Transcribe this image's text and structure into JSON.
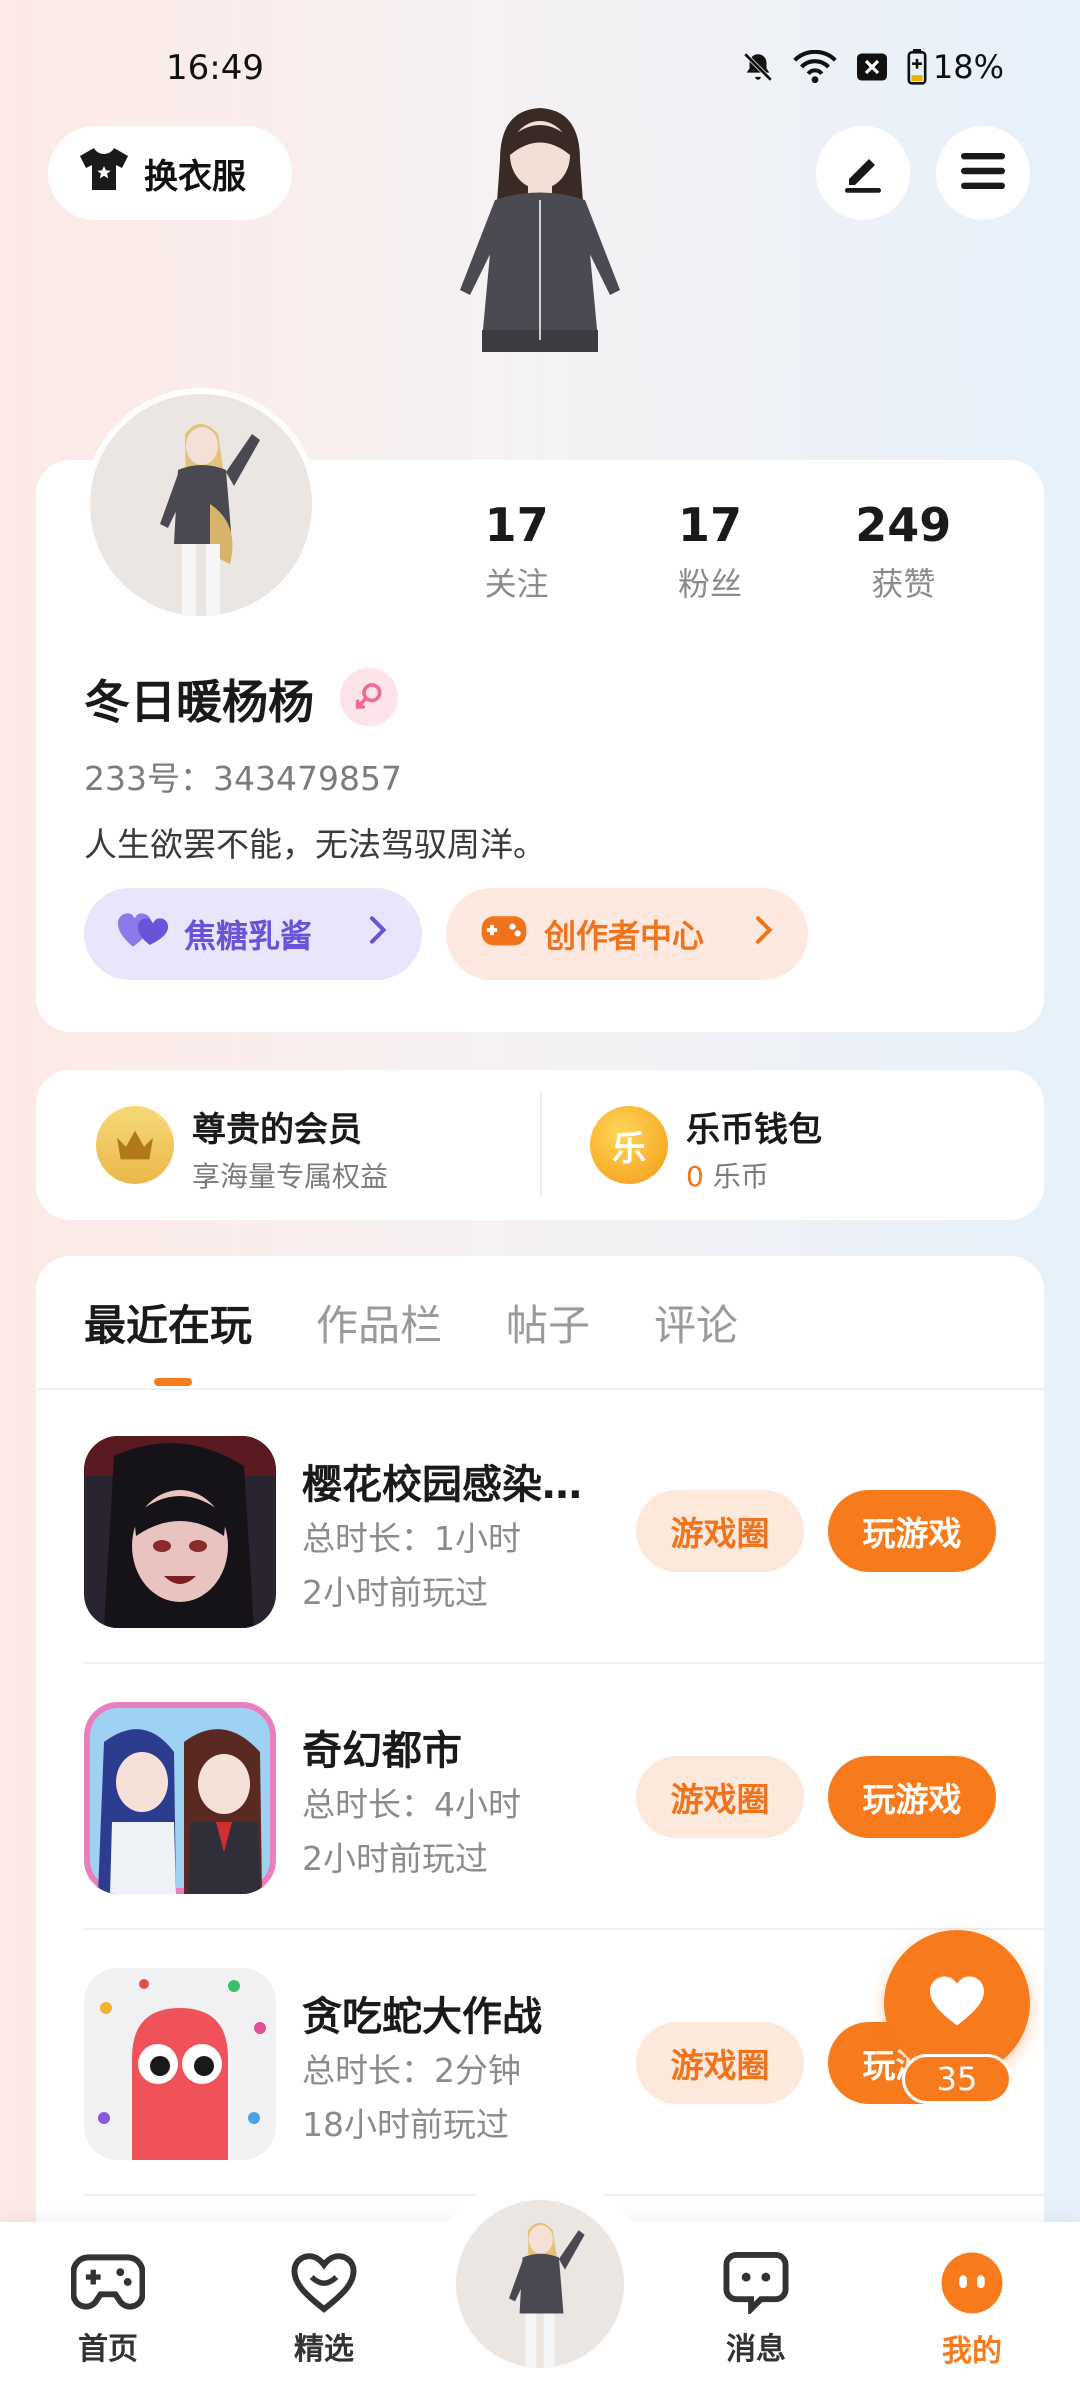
{
  "status": {
    "time": "16:49",
    "battery": "18%"
  },
  "top": {
    "outfit_label": "换衣服"
  },
  "profile": {
    "stats": [
      {
        "value": "17",
        "label": "关注"
      },
      {
        "value": "17",
        "label": "粉丝"
      },
      {
        "value": "249",
        "label": "获赞"
      }
    ],
    "nickname": "冬日暖杨杨",
    "uid": "233号：343479857",
    "bio": "人生欲罢不能，无法驾驭周洋。",
    "pill_left": "焦糖乳酱",
    "pill_right": "创作者中心"
  },
  "member": {
    "vip_title": "尊贵的会员",
    "vip_sub": "享海量专属权益",
    "wallet_title": "乐币钱包",
    "wallet_amount": "0",
    "wallet_unit": "乐币",
    "coin_glyph": "乐"
  },
  "tabs": [
    "最近在玩",
    "作品栏",
    "帖子",
    "评论"
  ],
  "games": [
    {
      "name": "樱花校园感染…",
      "duration": "总时长：1小时",
      "last": "2小时前玩过",
      "circle": "游戏圈",
      "play": "玩游戏"
    },
    {
      "name": "奇幻都市",
      "duration": "总时长：4小时",
      "last": "2小时前玩过",
      "circle": "游戏圈",
      "play": "玩游戏"
    },
    {
      "name": "贪吃蛇大作战",
      "duration": "总时长：2分钟",
      "last": "18小时前玩过",
      "circle": "游戏圈",
      "play": "玩游戏"
    }
  ],
  "like": {
    "count": "35"
  },
  "nav": [
    {
      "label": "首页"
    },
    {
      "label": "精选"
    },
    {
      "label": "消息"
    },
    {
      "label": "我的"
    }
  ],
  "colors": {
    "accent": "#f77b1d",
    "purple": "#6a53d8"
  }
}
